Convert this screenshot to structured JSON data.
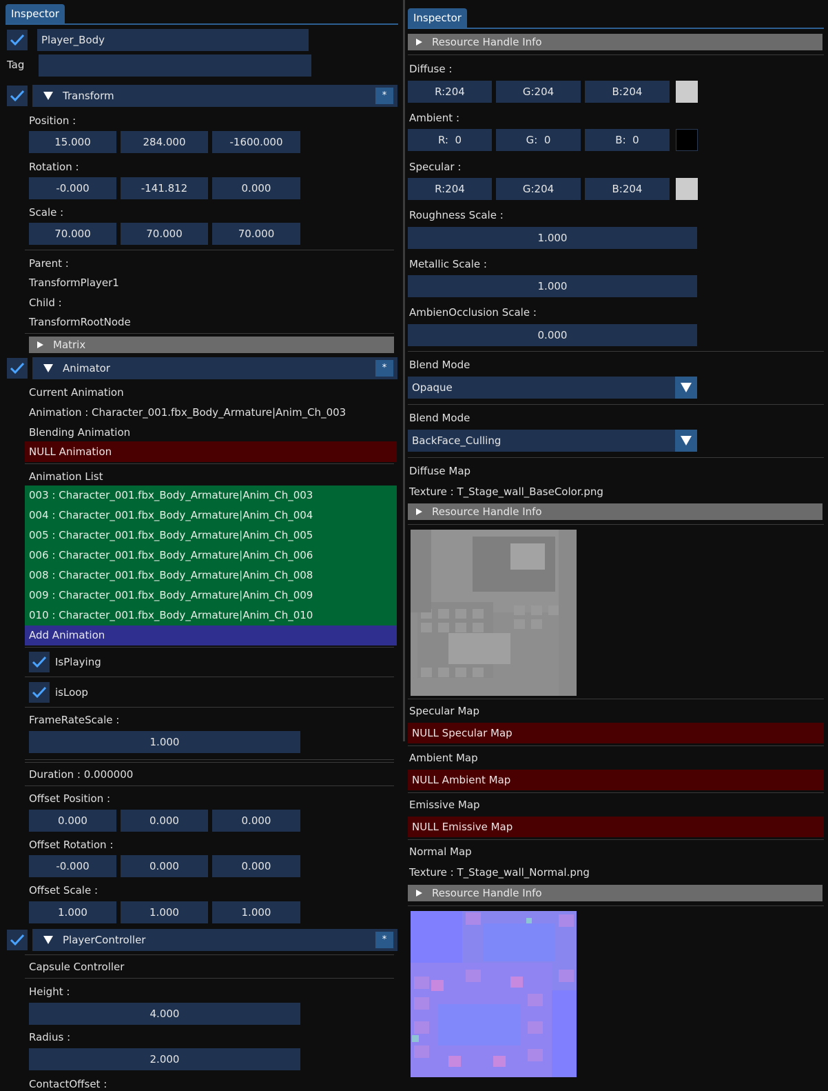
{
  "left": {
    "tab": "Inspector",
    "object_name": "Player_Body",
    "tag_label": "Tag",
    "tag_value": "",
    "transform": {
      "title": "Transform",
      "star": "*",
      "position_label": "Position :",
      "position": [
        "15.000",
        "284.000",
        "-1600.000"
      ],
      "rotation_label": "Rotation :",
      "rotation": [
        "-0.000",
        "-141.812",
        "0.000"
      ],
      "scale_label": "Scale :",
      "scale": [
        "70.000",
        "70.000",
        "70.000"
      ],
      "parent_label": "Parent :",
      "parent_value": "TransformPlayer1",
      "child_label": "Child :",
      "child_value": "TransformRootNode",
      "matrix_label": "Matrix"
    },
    "animator": {
      "title": "Animator",
      "star": "*",
      "current_label": "Current Animation",
      "current_value": "Animation : Character_001.fbx_Body_Armature|Anim_Ch_003",
      "blending_label": "Blending Animation",
      "blending_null": "NULL Animation",
      "list_label": "Animation List",
      "list": [
        "003 : Character_001.fbx_Body_Armature|Anim_Ch_003",
        "004 : Character_001.fbx_Body_Armature|Anim_Ch_004",
        "005 : Character_001.fbx_Body_Armature|Anim_Ch_005",
        "006 : Character_001.fbx_Body_Armature|Anim_Ch_006",
        "008 : Character_001.fbx_Body_Armature|Anim_Ch_008",
        "009 : Character_001.fbx_Body_Armature|Anim_Ch_009",
        "010 : Character_001.fbx_Body_Armature|Anim_Ch_010"
      ],
      "add_label": "Add Animation",
      "is_playing_label": "IsPlaying",
      "is_loop_label": "isLoop",
      "framerate_label": "FrameRateScale :",
      "framerate_value": "1.000",
      "duration": "Duration : 0.000000",
      "offset_position_label": "Offset Position :",
      "offset_position": [
        "0.000",
        "0.000",
        "0.000"
      ],
      "offset_rotation_label": "Offset Rotation :",
      "offset_rotation": [
        "-0.000",
        "0.000",
        "0.000"
      ],
      "offset_scale_label": "Offset Scale :",
      "offset_scale": [
        "1.000",
        "1.000",
        "1.000"
      ]
    },
    "player_controller": {
      "title": "PlayerController",
      "star": "*",
      "capsule_label": "Capsule Controller",
      "height_label": "Height :",
      "height_value": "4.000",
      "radius_label": "Radius :",
      "radius_value": "2.000",
      "contact_label": "ContactOffset :"
    }
  },
  "right": {
    "tab": "Inspector",
    "resource_handle_label": "Resource Handle Info",
    "diffuse_label": "Diffuse :",
    "diffuse": [
      "R:204",
      "G:204",
      "B:204"
    ],
    "diffuse_color": "#cccccc",
    "ambient_label": "Ambient :",
    "ambient": [
      "R:  0",
      "G:  0",
      "B:  0"
    ],
    "ambient_color": "#000000",
    "specular_label": "Specular :",
    "specular": [
      "R:204",
      "G:204",
      "B:204"
    ],
    "specular_color": "#cccccc",
    "roughness_label": "Roughness Scale :",
    "roughness_value": "1.000",
    "metallic_label": "Metallic Scale :",
    "metallic_value": "1.000",
    "ao_label": "AmbienOcclusion Scale :",
    "ao_value": "0.000",
    "blend_mode_label_1": "Blend Mode",
    "blend_mode_value_1": "Opaque",
    "blend_mode_label_2": "Blend Mode",
    "blend_mode_value_2": "BackFace_Culling",
    "diffuse_map_label": "Diffuse Map",
    "diffuse_map_texture": "Texture : T_Stage_wall_BaseColor.png",
    "specular_map_label": "Specular Map",
    "specular_map_null": "NULL Specular Map",
    "ambient_map_label": "Ambient Map",
    "ambient_map_null": "NULL Ambient Map",
    "emissive_map_label": "Emissive Map",
    "emissive_map_null": "NULL Emissive Map",
    "normal_map_label": "Normal Map",
    "normal_map_texture": "Texture : T_Stage_wall_Normal.png"
  },
  "colors": {
    "accent": "#2a5a8c",
    "field_bg": "#1f3350",
    "null_bg": "#4a0000",
    "list_bg": "#006633",
    "add_bg": "#2e2f8e"
  }
}
